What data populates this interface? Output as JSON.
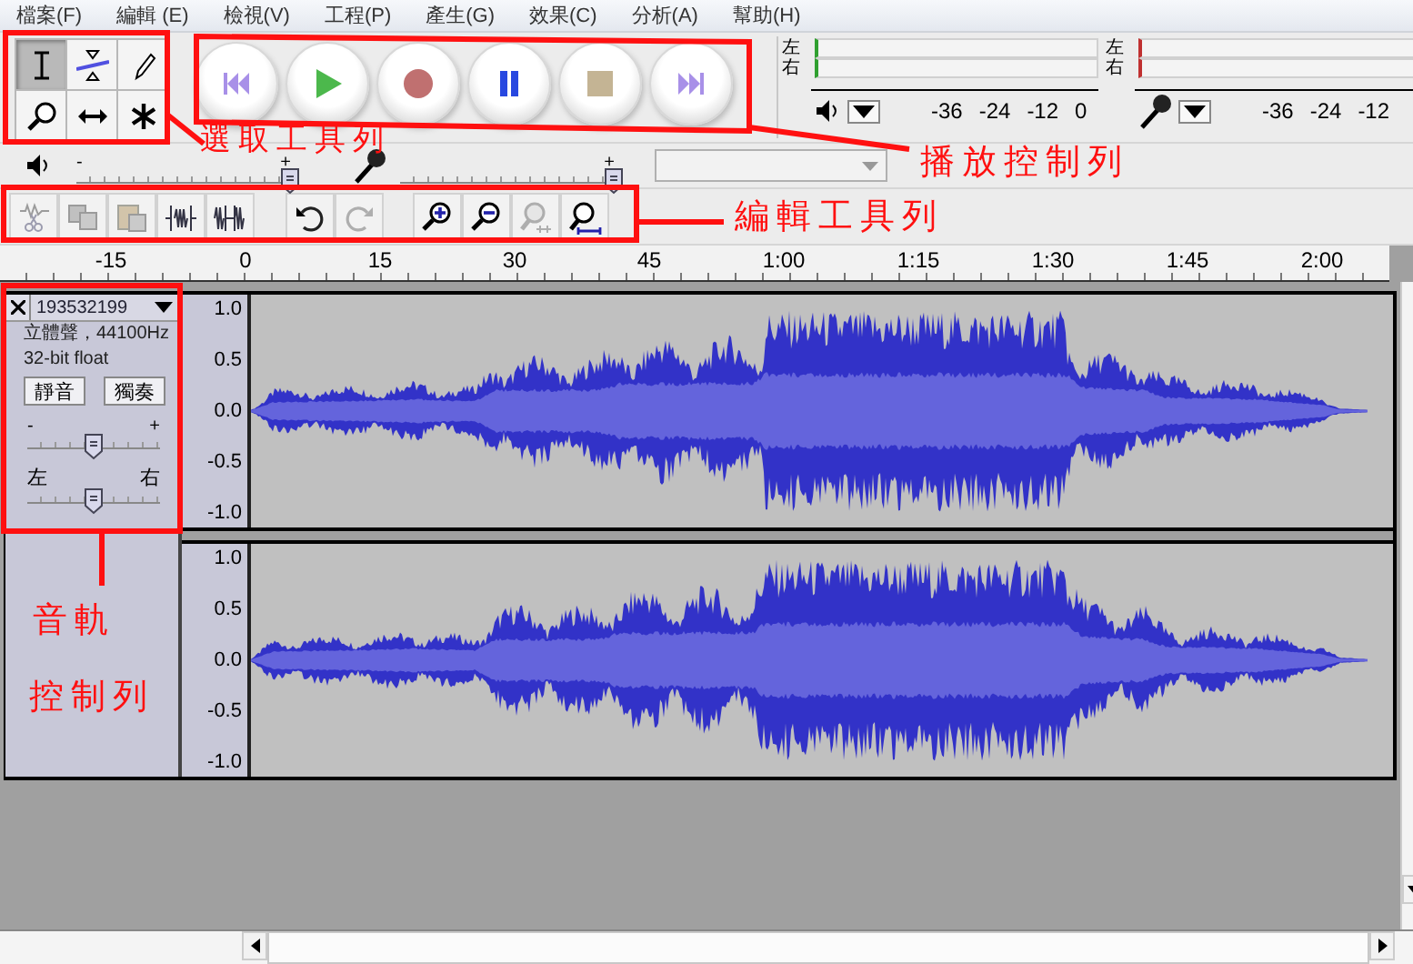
{
  "menu": [
    {
      "label": "檔案(F)"
    },
    {
      "label": "編輯 (E)"
    },
    {
      "label": "檢視(V)"
    },
    {
      "label": "工程(P)"
    },
    {
      "label": "產生(G)"
    },
    {
      "label": "效果(C)"
    },
    {
      "label": "分析(A)"
    },
    {
      "label": "幫助(H)"
    }
  ],
  "tools": [
    {
      "kind": "ibeam",
      "selected": true
    },
    {
      "kind": "envelope",
      "selected": false
    },
    {
      "kind": "pencil",
      "selected": false
    },
    {
      "kind": "zoom",
      "selected": false
    },
    {
      "kind": "timeshift",
      "selected": false
    },
    {
      "kind": "multi",
      "selected": false
    }
  ],
  "transport": [
    {
      "kind": "skip_start"
    },
    {
      "kind": "play"
    },
    {
      "kind": "record"
    },
    {
      "kind": "pause"
    },
    {
      "kind": "stop"
    },
    {
      "kind": "skip_end"
    }
  ],
  "meters": [
    {
      "kind": "playback",
      "channels": [
        "左",
        "右"
      ],
      "ticks": [
        "-36",
        "-24",
        "-12",
        "0"
      ]
    },
    {
      "kind": "recording",
      "channels": [
        "左",
        "右"
      ],
      "ticks": [
        "-36",
        "-24",
        "-12"
      ]
    }
  ],
  "mixer": {
    "output": {
      "minus": "-",
      "plus": "+",
      "level": 1
    },
    "input": {
      "plus": "+",
      "level": 1
    }
  },
  "edit_tools": [
    [
      {
        "kind": "cut",
        "disabled": true
      },
      {
        "kind": "copy",
        "disabled": true
      },
      {
        "kind": "paste",
        "disabled": true
      },
      {
        "kind": "trim",
        "disabled": false
      },
      {
        "kind": "silence",
        "disabled": false
      }
    ],
    [
      {
        "kind": "undo",
        "disabled": false
      },
      {
        "kind": "redo",
        "disabled": true
      }
    ],
    [
      {
        "kind": "zoom_in",
        "disabled": false
      },
      {
        "kind": "zoom_out",
        "disabled": false
      },
      {
        "kind": "fit_selection",
        "disabled": true
      },
      {
        "kind": "fit_project",
        "disabled": false
      }
    ]
  ],
  "ruler": [
    "-15",
    "0",
    "15",
    "30",
    "45",
    "1:00",
    "1:15",
    "1:30",
    "1:45",
    "2:00"
  ],
  "track": {
    "name": "193532199",
    "format": "立體聲，44100Hz",
    "sample_format": "32-bit float",
    "mute": "靜音",
    "solo": "獨奏",
    "gain": {
      "minus": "-",
      "plus": "+",
      "level": 0.5
    },
    "pan": {
      "left": "左",
      "right": "右",
      "level": 0.5
    },
    "channels": [
      {
        "scale": [
          "1.0",
          "0.5",
          "0.0",
          "-0.5",
          "-1.0"
        ]
      },
      {
        "scale": [
          "1.0",
          "0.5",
          "0.0",
          "-0.5",
          "-1.0"
        ]
      }
    ]
  },
  "annotations": [
    {
      "text": "選取工具列"
    },
    {
      "text": "播放控制列"
    },
    {
      "text": "編輯工具列"
    },
    {
      "text": "音軌"
    },
    {
      "text": "控制列"
    }
  ]
}
